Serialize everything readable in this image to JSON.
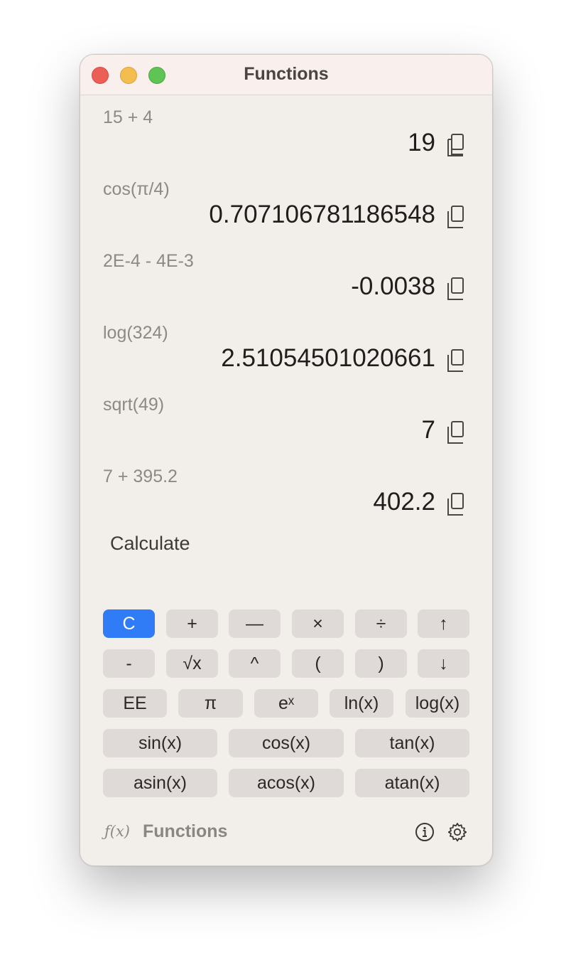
{
  "window": {
    "title": "Functions"
  },
  "history": [
    {
      "expression": "15 + 4",
      "result": "19"
    },
    {
      "expression": "cos(π/4)",
      "result": "0.707106781186548"
    },
    {
      "expression": "2E-4 - 4E-3",
      "result": "-0.0038"
    },
    {
      "expression": "log(324)",
      "result": "2.51054501020661"
    },
    {
      "expression": "sqrt(49)",
      "result": "7"
    },
    {
      "expression": "7 + 395.2",
      "result": "402.2"
    }
  ],
  "input": {
    "label": "Calculate"
  },
  "keypad": {
    "row1": [
      "C",
      "+",
      "—",
      "×",
      "÷",
      "↑"
    ],
    "row2": [
      "-",
      "√x",
      "^",
      "(",
      ")",
      "↓"
    ],
    "row3": [
      "EE",
      "π",
      "eˣ",
      "ln(x)",
      "log(x)"
    ],
    "row4": [
      "sin(x)",
      "cos(x)",
      "tan(x)"
    ],
    "row5": [
      "asin(x)",
      "acos(x)",
      "atan(x)"
    ]
  },
  "footer": {
    "icon_text": "ƒ(x)",
    "title": "Functions"
  },
  "icons": {
    "copy": "copy-icon",
    "info": "info-icon",
    "settings": "gear-icon",
    "footer": "function-icon"
  },
  "colors": {
    "accent": "#2f7cf6",
    "background": "#f2eeea",
    "titlebar": "#f9efec"
  }
}
